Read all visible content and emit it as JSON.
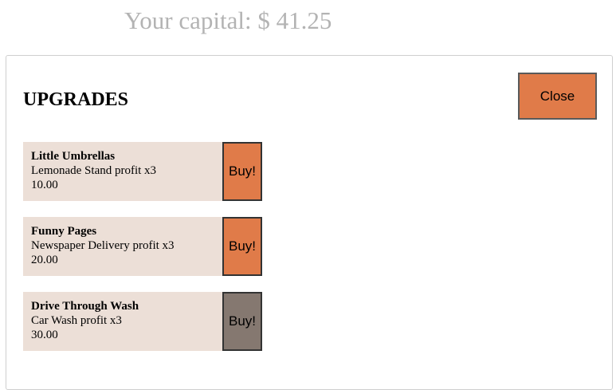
{
  "capital": {
    "text": "Your capital: $ 41.25"
  },
  "dialog": {
    "title": "UPGRADES",
    "close_label": "Close"
  },
  "upgrades": [
    {
      "name": "Little Umbrellas",
      "description": "Lemonade Stand profit x3",
      "cost": "10.00",
      "buy_label": "Buy!",
      "affordable": true
    },
    {
      "name": "Funny Pages",
      "description": "Newspaper Delivery profit x3",
      "cost": "20.00",
      "buy_label": "Buy!",
      "affordable": true
    },
    {
      "name": "Drive Through Wash",
      "description": "Car Wash profit x3",
      "cost": "30.00",
      "buy_label": "Buy!",
      "affordable": false
    }
  ],
  "colors": {
    "button_enabled": "#e07b49",
    "button_disabled": "#857870",
    "card_background": "#ecdfd7",
    "capital_text": "#b3b3b3"
  }
}
